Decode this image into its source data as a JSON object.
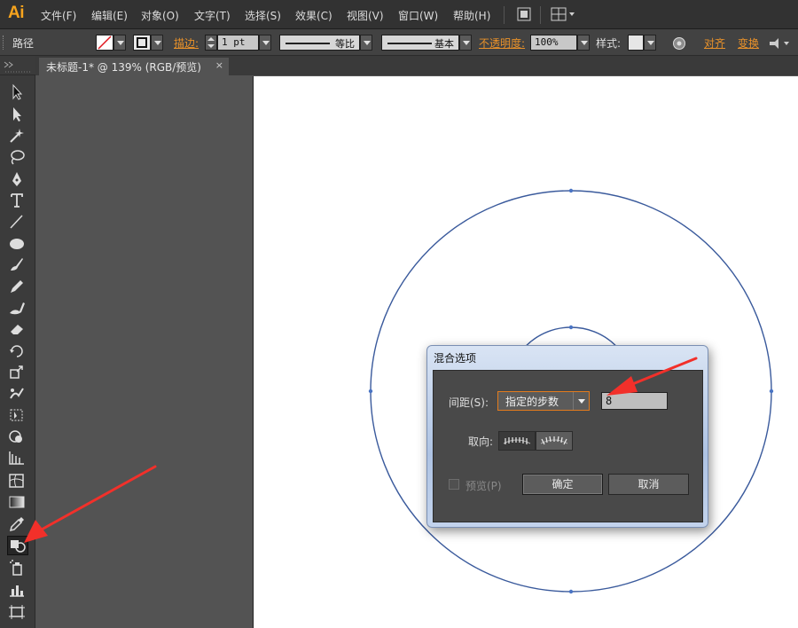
{
  "app": {
    "logo": "Ai"
  },
  "menu": [
    "文件(F)",
    "编辑(E)",
    "对象(O)",
    "文字(T)",
    "选择(S)",
    "效果(C)",
    "视图(V)",
    "窗口(W)",
    "帮助(H)"
  ],
  "control_bar": {
    "object_type": "路径",
    "stroke_label": "描边:",
    "stroke_weight": "1 pt",
    "profile": "等比",
    "brush": "基本",
    "opacity_label": "不透明度:",
    "opacity_value": "100%",
    "style_label": "样式:",
    "align_link": "对齐",
    "transform_link": "变换"
  },
  "document_tab": {
    "title": "未标题-1* @ 139% (RGB/预览)",
    "close": "×"
  },
  "blend_dialog": {
    "title": "混合选项",
    "spacing_label": "间距(S):",
    "spacing_value": "指定的步数",
    "steps_value": "8",
    "orientation_label": "取向:",
    "preview_label": "预览(P)",
    "ok_label": "确定",
    "cancel_label": "取消"
  },
  "colors": {
    "accent": "#e8912a",
    "path_stroke": "#3a5a9c",
    "arrow": "#ff3b30"
  }
}
